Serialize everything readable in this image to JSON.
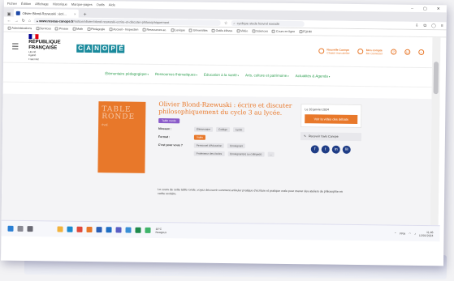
{
  "browser": {
    "menu": [
      "Fichier",
      "Édition",
      "Affichage",
      "Historique",
      "Marque-pages",
      "Outils",
      "Aide"
    ],
    "tab_title": "Olivier Blond-Rzewuski : écri...",
    "url_host": "www.reseau-canope.fr",
    "url_path": "/notice/olivier-blond-rzewuski-ecrire-et-discuter-philosophiquement",
    "search_placeholder": "cyclique stede fesvrel exeade",
    "bookmarks": [
      "Administrations",
      "Services",
      "Presse",
      "Math",
      "Pédagogie",
      "Accueil - Inspection",
      "Ressources ac.",
      "Lexique",
      "Universités",
      "Outils élèves",
      "Vidéo",
      "Sciences",
      "Cours en ligne",
      "FQHM"
    ]
  },
  "site": {
    "republic": [
      "RÉPUBLIQUE",
      "FRANÇAISE"
    ],
    "motto": [
      "Liberté",
      "Égalité",
      "Fraternité"
    ],
    "brand_letters": [
      "C",
      "A",
      "N",
      "O",
      "P",
      "É"
    ],
    "header_links": [
      {
        "line1": "Nouvelle Canope",
        "line2": "Choisir mon atelier"
      },
      {
        "line1": "Mon compte",
        "line2": "Me connecter"
      }
    ],
    "nav": [
      "Élémentaire pédagogique",
      "Ressources thématiques",
      "Éducation à la santé",
      "Arts, culture et patrimoine",
      "Actualités & Agenda"
    ],
    "flag_colors": [
      "#000091",
      "#ffffff",
      "#e1000f"
    ],
    "accent_color": "#e8782a",
    "brand_color": "#1a8a9c",
    "nav_color": "#2b9d4e"
  },
  "product": {
    "cover_title": [
      "TABLE",
      "RONDE"
    ],
    "cover_sub": "éval.",
    "title": "Olivier Blond-Rzewuski : écrire et discuter philosophiquement du cycle 3 au lycée.",
    "badge": "Table ronde",
    "rows": [
      {
        "label": "Niveaux :",
        "chips": [
          "Élémentaire",
          "Collège",
          "Lycée"
        ],
        "orange": false
      },
      {
        "label": "Format :",
        "chips": [
          "Vidéo"
        ],
        "orange": true
      },
      {
        "label": "C'est pour vous ?",
        "chips": [
          "Personnel d'éducation",
          "Enseignant",
          "Professeur des écoles",
          "Enseignant(e) au collège(e)",
          "..."
        ],
        "orange": false
      }
    ],
    "description": "Le cours de cette table ronde, voyez découvrir comment articuler pratique d'écriture et pratique orale pour mener des ateliers de philosophie en cadre scolaire."
  },
  "sidebar": {
    "date": "Le 10 janvier 2024",
    "cta": "Voir la vidéo des débats",
    "alert": "Recevoir l'avis Canopé"
  },
  "taskbar": {
    "weather_temp": "10°C",
    "weather_desc": "Nuageux",
    "time": "11:46",
    "date": "12/01/2024",
    "lang": "FRA"
  }
}
